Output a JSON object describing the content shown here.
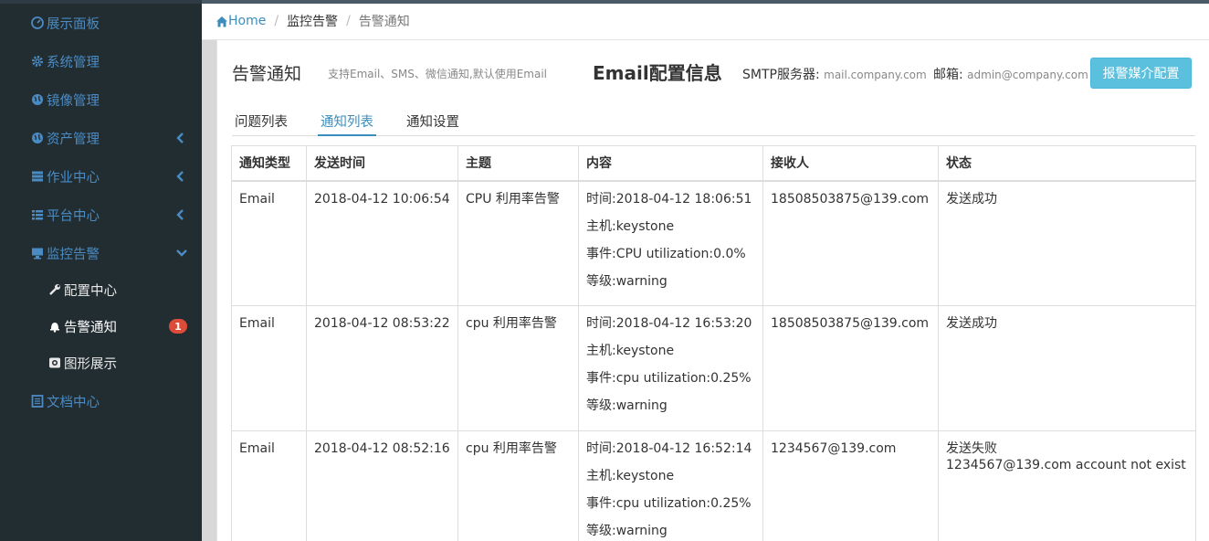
{
  "sidebar": {
    "items": [
      {
        "label": "展示面板",
        "icon": "dashboard-icon",
        "has_chevron": false
      },
      {
        "label": "系统管理",
        "icon": "gear-icon",
        "has_chevron": false
      },
      {
        "label": "镜像管理",
        "icon": "globe-icon",
        "has_chevron": false
      },
      {
        "label": "资产管理",
        "icon": "globe-icon",
        "has_chevron": true,
        "chevron": "left"
      },
      {
        "label": "作业中心",
        "icon": "server-icon",
        "has_chevron": true,
        "chevron": "left"
      },
      {
        "label": "平台中心",
        "icon": "list-icon",
        "has_chevron": true,
        "chevron": "left"
      },
      {
        "label": "监控告警",
        "icon": "monitor-icon",
        "has_chevron": true,
        "chevron": "down"
      }
    ],
    "subitems": [
      {
        "label": "配置中心",
        "icon": "wrench-icon"
      },
      {
        "label": "告警通知",
        "icon": "bell-icon",
        "badge": "1"
      },
      {
        "label": "图形展示",
        "icon": "chart-icon"
      }
    ],
    "docs": {
      "label": "文档中心",
      "icon": "book-icon"
    }
  },
  "breadcrumb": {
    "home": "Home",
    "level1": "监控告警",
    "level2": "告警通知"
  },
  "header": {
    "title": "告警通知",
    "subtitle": "支持Email、SMS、微信通知,默认使用Email",
    "email_title": "Email配置信息",
    "smtp_label": "SMTP服务器:",
    "smtp_value": "mail.company.com",
    "mailbox_label": "邮箱:",
    "mailbox_value": "admin@company.com",
    "config_button": "报警媒介配置"
  },
  "tabs": [
    {
      "label": "问题列表",
      "active": false
    },
    {
      "label": "通知列表",
      "active": true
    },
    {
      "label": "通知设置",
      "active": false
    }
  ],
  "table": {
    "columns": [
      "通知类型",
      "发送时间",
      "主题",
      "内容",
      "接收人",
      "状态"
    ],
    "rows": [
      {
        "type": "Email",
        "time": "2018-04-12 10:06:54",
        "subject": "CPU 利用率告警",
        "content": [
          "时间:2018-04-12 18:06:51",
          "主机:keystone",
          "事件:CPU utilization:0.0%",
          "等级:warning"
        ],
        "receiver": "18508503875@139.com",
        "status": "发送成功",
        "status_detail": "",
        "status_color": "#108a10"
      },
      {
        "type": "Email",
        "time": "2018-04-12 08:53:22",
        "subject": "cpu 利用率告警",
        "content": [
          "时间:2018-04-12 16:53:20",
          "主机:keystone",
          "事件:cpu utilization:0.25%",
          "等级:warning"
        ],
        "receiver": "18508503875@139.com",
        "status": "发送成功",
        "status_detail": "",
        "status_color": "#108a10"
      },
      {
        "type": "Email",
        "time": "2018-04-12 08:52:16",
        "subject": "cpu 利用率告警",
        "content": [
          "时间:2018-04-12 16:52:14",
          "主机:keystone",
          "事件:cpu utilization:0.25%",
          "等级:warning"
        ],
        "receiver": "1234567@139.com",
        "status": "发送失败",
        "status_detail": "1234567@139.com account not exist",
        "status_color": "#e02020"
      }
    ]
  },
  "colors": {
    "sidebar_bg": "#222d32",
    "accent": "#3c8dbc",
    "success": "#108a10",
    "danger": "#e02020",
    "info_button": "#5bc0de"
  }
}
